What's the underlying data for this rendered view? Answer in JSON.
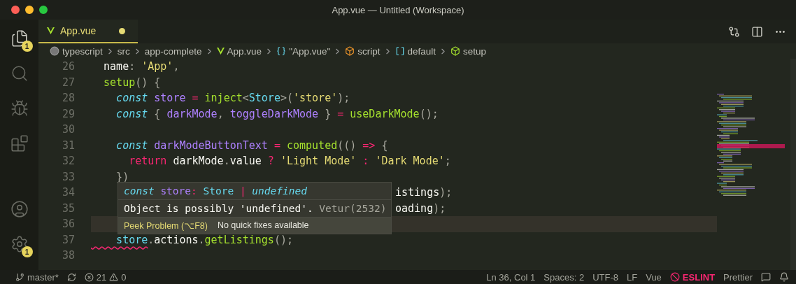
{
  "window": {
    "title": "App.vue — Untitled (Workspace)"
  },
  "activity_bar": [
    {
      "kind": "files",
      "selected": true,
      "badge": "1"
    },
    {
      "kind": "search",
      "selected": false
    },
    {
      "kind": "debug",
      "selected": false
    },
    {
      "kind": "extensions",
      "selected": false
    },
    {
      "kind": "account",
      "selected": false
    },
    {
      "kind": "settings",
      "selected": false,
      "badge": "1"
    }
  ],
  "tabs": [
    {
      "label": "App.vue",
      "selected": true,
      "modified": true
    }
  ],
  "breadcrumbs": [
    {
      "kind": "folder",
      "label": "typescript"
    },
    {
      "kind": "plain",
      "label": "src"
    },
    {
      "kind": "plain",
      "label": "app-complete"
    },
    {
      "kind": "vue",
      "label": "App.vue"
    },
    {
      "kind": "object",
      "label": "\"App.vue\""
    },
    {
      "kind": "module",
      "label": "script"
    },
    {
      "kind": "field",
      "label": "default"
    },
    {
      "kind": "method",
      "label": "setup"
    }
  ],
  "editor": {
    "lines": [
      {
        "number": "26",
        "current": false,
        "tokens": [
          {
            "kind": "plain",
            "text": "  name"
          },
          {
            "kind": "punct",
            "text": ": "
          },
          {
            "kind": "string",
            "text": "'App'"
          },
          {
            "kind": "punct",
            "text": ","
          }
        ]
      },
      {
        "number": "27",
        "current": false,
        "tokens": [
          {
            "kind": "func",
            "text": "  setup"
          },
          {
            "kind": "punct",
            "text": "() {"
          }
        ]
      },
      {
        "number": "28",
        "current": false,
        "tokens": [
          {
            "kind": "keyword",
            "text": "    const"
          },
          {
            "kind": "var",
            "text": " store"
          },
          {
            "kind": "op",
            "text": " ="
          },
          {
            "kind": "func",
            "text": " inject"
          },
          {
            "kind": "punct",
            "text": "<"
          },
          {
            "kind": "type",
            "text": "Store"
          },
          {
            "kind": "punct",
            "text": ">("
          },
          {
            "kind": "string",
            "text": "'store'"
          },
          {
            "kind": "punct",
            "text": ");"
          }
        ]
      },
      {
        "number": "29",
        "current": false,
        "tokens": [
          {
            "kind": "keyword",
            "text": "    const"
          },
          {
            "kind": "punct",
            "text": " { "
          },
          {
            "kind": "var",
            "text": "darkMode"
          },
          {
            "kind": "punct",
            "text": ", "
          },
          {
            "kind": "var",
            "text": "toggleDarkMode"
          },
          {
            "kind": "punct",
            "text": " } "
          },
          {
            "kind": "op",
            "text": "="
          },
          {
            "kind": "func",
            "text": " useDarkMode"
          },
          {
            "kind": "punct",
            "text": "();"
          }
        ]
      },
      {
        "number": "30",
        "current": false
      },
      {
        "number": "31",
        "current": false,
        "tokens": [
          {
            "kind": "keyword",
            "text": "    const"
          },
          {
            "kind": "var",
            "text": " darkModeButtonText"
          },
          {
            "kind": "op",
            "text": " ="
          },
          {
            "kind": "func",
            "text": " computed"
          },
          {
            "kind": "punct",
            "text": "(() "
          },
          {
            "kind": "op",
            "text": "=>"
          },
          {
            "kind": "punct",
            "text": " {"
          }
        ]
      },
      {
        "number": "32",
        "current": false,
        "tokens": [
          {
            "kind": "op",
            "text": "      return"
          },
          {
            "kind": "plain",
            "text": " darkMode"
          },
          {
            "kind": "punct",
            "text": "."
          },
          {
            "kind": "plain",
            "text": "value"
          },
          {
            "kind": "op",
            "text": " ?"
          },
          {
            "kind": "string",
            "text": " 'Light Mode'"
          },
          {
            "kind": "op",
            "text": " :"
          },
          {
            "kind": "string",
            "text": " 'Dark Mode'"
          },
          {
            "kind": "punct",
            "text": ";"
          }
        ]
      },
      {
        "number": "33",
        "current": false,
        "tokens": [
          {
            "kind": "punct",
            "text": "    })"
          }
        ]
      },
      {
        "number": "34",
        "current": false,
        "covered": true,
        "tokens": [
          {
            "kind": "plain",
            "text": "istings"
          },
          {
            "kind": "punct",
            "text": ");"
          }
        ]
      },
      {
        "number": "35",
        "current": false,
        "covered": true,
        "tokens": [
          {
            "kind": "plain",
            "text": "oading"
          },
          {
            "kind": "punct",
            "text": ");"
          }
        ]
      },
      {
        "number": "36",
        "current": true
      },
      {
        "number": "37",
        "current": false,
        "tokens": [
          {
            "kind": "error",
            "text": "    store"
          },
          {
            "kind": "punct",
            "text": "."
          },
          {
            "kind": "plain",
            "text": "actions"
          },
          {
            "kind": "punct",
            "text": "."
          },
          {
            "kind": "func",
            "text": "getListings"
          },
          {
            "kind": "punct",
            "text": "();"
          }
        ]
      },
      {
        "number": "38",
        "current": false
      }
    ]
  },
  "hover": {
    "signature": [
      {
        "kind": "keyword",
        "text": "const"
      },
      {
        "kind": "var",
        "text": " store"
      },
      {
        "kind": "op",
        "text": ":"
      },
      {
        "kind": "type",
        "text": " Store"
      },
      {
        "kind": "op",
        "text": " |"
      },
      {
        "kind": "keyword",
        "text": " undefined"
      }
    ],
    "message": "Object is possibly 'undefined'.",
    "source": "Vetur(2532)",
    "action": "Peek Problem (⌥F8)",
    "note": "No quick fixes available"
  },
  "status_bar": {
    "branch": "master*",
    "errors": "21",
    "warnings": "0",
    "right": [
      {
        "kind": "text",
        "label": "Ln 36, Col 1"
      },
      {
        "kind": "text",
        "label": "Spaces: 2"
      },
      {
        "kind": "text",
        "label": "UTF-8"
      },
      {
        "kind": "text",
        "label": "LF"
      },
      {
        "kind": "text",
        "label": "Vue"
      },
      {
        "kind": "error",
        "label": "ESLINT"
      },
      {
        "kind": "text",
        "label": "Prettier"
      }
    ]
  }
}
